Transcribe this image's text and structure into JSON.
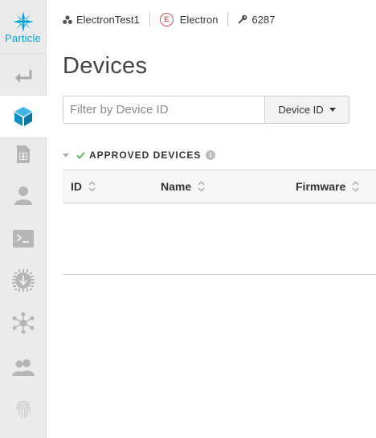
{
  "brand": {
    "name": "Particle",
    "color": "#00a4d9"
  },
  "sidebar": {
    "items": [
      {
        "id": "back",
        "icon": "back-arrow-icon",
        "active": false
      },
      {
        "id": "devices",
        "icon": "cube-icon",
        "active": true
      },
      {
        "id": "sims",
        "icon": "sim-card-icon",
        "active": false
      },
      {
        "id": "account",
        "icon": "user-icon",
        "active": false
      },
      {
        "id": "console",
        "icon": "terminal-icon",
        "active": false
      },
      {
        "id": "integrations",
        "icon": "chip-icon",
        "active": false
      },
      {
        "id": "network",
        "icon": "network-icon",
        "active": false
      },
      {
        "id": "team",
        "icon": "team-icon",
        "active": false
      },
      {
        "id": "auth",
        "icon": "fingerprint-icon",
        "active": false
      }
    ]
  },
  "topbar": {
    "product": "ElectronTest1",
    "platform_badge": "E",
    "platform": "Electron",
    "product_id": "6287"
  },
  "page": {
    "title": "Devices"
  },
  "filter": {
    "placeholder": "Filter by Device ID",
    "value": "",
    "selected_option": "Device ID"
  },
  "section": {
    "title": "APPROVED DEVICES",
    "info": "i",
    "check_color": "#5cb85c"
  },
  "table": {
    "columns": [
      "ID",
      "Name",
      "Firmware"
    ],
    "rows": []
  }
}
